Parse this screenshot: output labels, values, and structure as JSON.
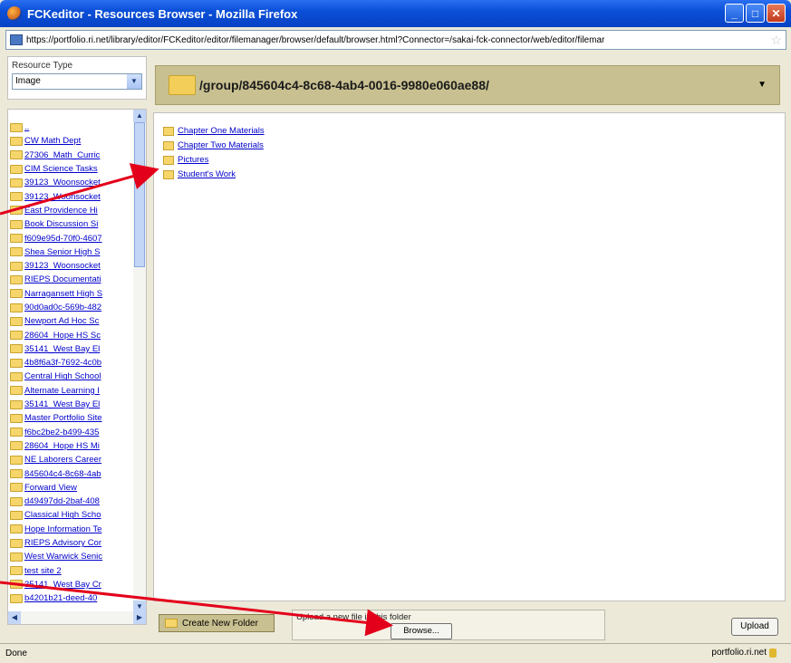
{
  "window": {
    "title": "FCKeditor - Resources Browser - Mozilla Firefox",
    "buttons": [
      "_",
      "□",
      "✕"
    ]
  },
  "urlbar": {
    "url": "https://portfolio.ri.net/library/editor/FCKeditor/editor/filemanager/browser/default/browser.html?Connector=/sakai-fck-connector/web/editor/filemar"
  },
  "resource_type": {
    "label": "Resource Type",
    "value": "Image"
  },
  "tree": {
    "items": [
      "..",
      "CW Math Dept",
      "27306_Math_Curric",
      "CIM Science Tasks",
      "39123_Woonsocket",
      "39123_Woonsocket",
      "East Providence Hi",
      "Book Discussion Si",
      "f609e95d-70f0-4607",
      "Shea Senior High S",
      "39123_Woonsocket",
      "RIEPS Documentati",
      "Narragansett High S",
      "90d0ad0c-569b-482",
      "Newport Ad Hoc Sc",
      "28604_Hope HS Sc",
      "35141_West Bay El",
      "4b8f6a3f-7692-4c0b",
      "Central High School",
      "Alternate Learning I",
      "35141_West Bay El",
      "Master Portfolio Site",
      "f6bc2be2-b499-435",
      "28604_Hope HS Mi",
      "NE Laborers Career",
      "845604c4-8c68-4ab",
      "Forward View",
      "d49497dd-2baf-408",
      "Classical High Scho",
      "Hope Information Te",
      "RIEPS Advisory Cor",
      "West Warwick Senic",
      "test site 2",
      "35141_West Bay Cr",
      "b4201b21-deed-40"
    ]
  },
  "path": {
    "current": "/group/845604c4-8c68-4ab4-0016-9980e060ae88/",
    "dropdown_icon": "▼"
  },
  "files": [
    "Chapter One Materials",
    "Chapter Two Materials",
    "Pictures",
    "Student's Work"
  ],
  "actions": {
    "create_folder": "Create New Folder",
    "upload_label": "Upload a new file in this folder",
    "browse": "Browse...",
    "upload": "Upload"
  },
  "status": {
    "left": "Done",
    "right": "portfolio.ri.net"
  }
}
